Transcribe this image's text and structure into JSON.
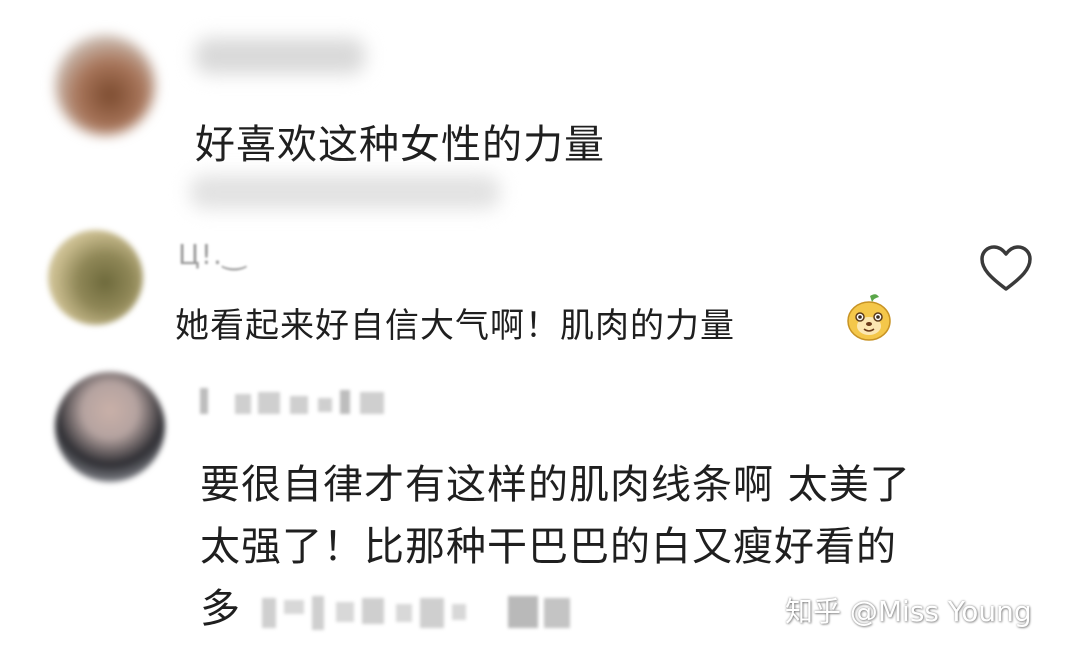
{
  "comments": [
    {
      "text": "好喜欢这种女性的力量"
    },
    {
      "text": "她看起来好自信大气啊！肌肉的力量",
      "username": "Ц!.‿"
    },
    {
      "lines": [
        "要很自律才有这样的肌肉线条啊 太美了",
        "太强了！比那种干巴巴的白又瘦好看的",
        "多"
      ]
    }
  ],
  "icons": {
    "like": "heart-outline-icon",
    "emoji": "cute-mascot-emoji-icon"
  },
  "watermark": "知乎 @Miss Young"
}
